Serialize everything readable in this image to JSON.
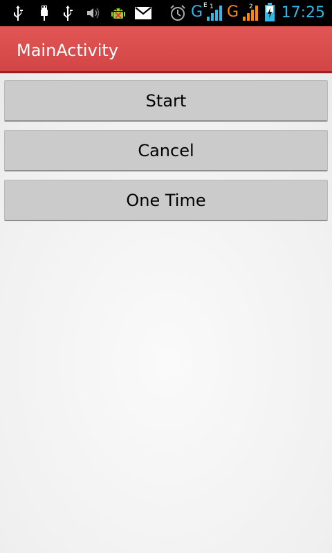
{
  "status_bar": {
    "icons": [
      "usb-icon",
      "usb-plug-icon",
      "usb-icon",
      "speaker-icon",
      "android-debug-icon",
      "email-icon",
      "alarm-icon",
      "signal-icon",
      "signal-icon",
      "battery-charging-icon"
    ],
    "network1": "G",
    "network1_sub_top": "E",
    "network1_sub_num": "1",
    "network2": "G",
    "network2_sub_num": "2",
    "time": "17:25",
    "accent_color": "#33b5e5",
    "network2_color": "#ff8800"
  },
  "action_bar": {
    "title": "MainActivity",
    "color": "#d94b4b"
  },
  "buttons": {
    "start_label": "Start",
    "cancel_label": "Cancel",
    "one_time_label": "One Time"
  }
}
